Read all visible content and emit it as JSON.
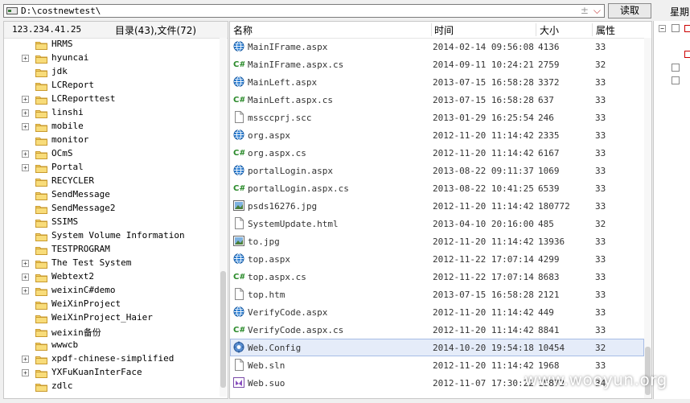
{
  "address_bar": {
    "path": "D:\\costnewtest\\",
    "controls": "±",
    "read_button": "读取"
  },
  "weekday_label": "星期",
  "left_pane": {
    "ip": "123.234.41.25",
    "summary": "目录(43),文件(72)",
    "folders": [
      {
        "name": "HRMS",
        "expandable": false
      },
      {
        "name": "hyuncai",
        "expandable": true
      },
      {
        "name": "jdk",
        "expandable": false
      },
      {
        "name": "LCReport",
        "expandable": false
      },
      {
        "name": "LCReporttest",
        "expandable": true
      },
      {
        "name": "linshi",
        "expandable": true
      },
      {
        "name": "mobile",
        "expandable": true
      },
      {
        "name": "monitor",
        "expandable": false
      },
      {
        "name": "OCmS",
        "expandable": true
      },
      {
        "name": "Portal",
        "expandable": true
      },
      {
        "name": "RECYCLER",
        "expandable": false
      },
      {
        "name": "SendMessage",
        "expandable": false
      },
      {
        "name": "SendMessage2",
        "expandable": false
      },
      {
        "name": "SSIMS",
        "expandable": false
      },
      {
        "name": "System Volume Information",
        "expandable": false
      },
      {
        "name": "TESTPROGRAM",
        "expandable": false
      },
      {
        "name": "The Test System",
        "expandable": true
      },
      {
        "name": "Webtext2",
        "expandable": true
      },
      {
        "name": "weixinC#demo",
        "expandable": true
      },
      {
        "name": "WeiXinProject",
        "expandable": false
      },
      {
        "name": "WeiXinProject_Haier",
        "expandable": false
      },
      {
        "name": "weixin备份",
        "expandable": false
      },
      {
        "name": "wwwcb",
        "expandable": false
      },
      {
        "name": "xpdf-chinese-simplified",
        "expandable": true
      },
      {
        "name": "YXFuKuanInterFace",
        "expandable": true
      },
      {
        "name": "zdlc",
        "expandable": false
      }
    ]
  },
  "columns": {
    "name": "名称",
    "time": "时间",
    "size": "大小",
    "attr": "属性"
  },
  "files": [
    {
      "name": "MainIFrame.aspx",
      "time": "2014-02-14 09:56:08",
      "size": "4136",
      "attr": "33",
      "icon": "globe-icon"
    },
    {
      "name": "MainIFrame.aspx.cs",
      "time": "2014-09-11 10:24:21",
      "size": "2759",
      "attr": "32",
      "icon": "csharp-icon"
    },
    {
      "name": "MainLeft.aspx",
      "time": "2013-07-15 16:58:28",
      "size": "3372",
      "attr": "33",
      "icon": "globe-icon"
    },
    {
      "name": "MainLeft.aspx.cs",
      "time": "2013-07-15 16:58:28",
      "size": "637",
      "attr": "33",
      "icon": "csharp-icon"
    },
    {
      "name": "mssccprj.scc",
      "time": "2013-01-29 16:25:54",
      "size": "246",
      "attr": "33",
      "icon": "file-icon"
    },
    {
      "name": "org.aspx",
      "time": "2012-11-20 11:14:42",
      "size": "2335",
      "attr": "33",
      "icon": "globe-icon"
    },
    {
      "name": "org.aspx.cs",
      "time": "2012-11-20 11:14:42",
      "size": "6167",
      "attr": "33",
      "icon": "csharp-icon"
    },
    {
      "name": "portalLogin.aspx",
      "time": "2013-08-22 09:11:37",
      "size": "1069",
      "attr": "33",
      "icon": "globe-icon"
    },
    {
      "name": "portalLogin.aspx.cs",
      "time": "2013-08-22 10:41:25",
      "size": "6539",
      "attr": "33",
      "icon": "csharp-icon"
    },
    {
      "name": "psds16276.jpg",
      "time": "2012-11-20 11:14:42",
      "size": "180772",
      "attr": "33",
      "icon": "image-icon"
    },
    {
      "name": "SystemUpdate.html",
      "time": "2013-04-10 20:16:00",
      "size": "485",
      "attr": "32",
      "icon": "file-icon"
    },
    {
      "name": "to.jpg",
      "time": "2012-11-20 11:14:42",
      "size": "13936",
      "attr": "33",
      "icon": "image-icon"
    },
    {
      "name": "top.aspx",
      "time": "2012-11-22 17:07:14",
      "size": "4299",
      "attr": "33",
      "icon": "globe-icon"
    },
    {
      "name": "top.aspx.cs",
      "time": "2012-11-22 17:07:14",
      "size": "8683",
      "attr": "33",
      "icon": "csharp-icon"
    },
    {
      "name": "top.htm",
      "time": "2013-07-15 16:58:28",
      "size": "2121",
      "attr": "33",
      "icon": "file-icon"
    },
    {
      "name": "VerifyCode.aspx",
      "time": "2012-11-20 11:14:42",
      "size": "449",
      "attr": "33",
      "icon": "globe-icon"
    },
    {
      "name": "VerifyCode.aspx.cs",
      "time": "2012-11-20 11:14:42",
      "size": "8841",
      "attr": "33",
      "icon": "csharp-icon"
    },
    {
      "name": "Web.Config",
      "time": "2014-10-20 19:54:18",
      "size": "10454",
      "attr": "32",
      "icon": "config-icon",
      "selected": true
    },
    {
      "name": "Web.sln",
      "time": "2012-11-20 11:14:42",
      "size": "1968",
      "attr": "33",
      "icon": "file-icon"
    },
    {
      "name": "Web.suo",
      "time": "2012-11-07 17:30:22",
      "size": "15872",
      "attr": "34",
      "icon": "vs-icon"
    }
  ],
  "watermark": "www.wooyun.org"
}
